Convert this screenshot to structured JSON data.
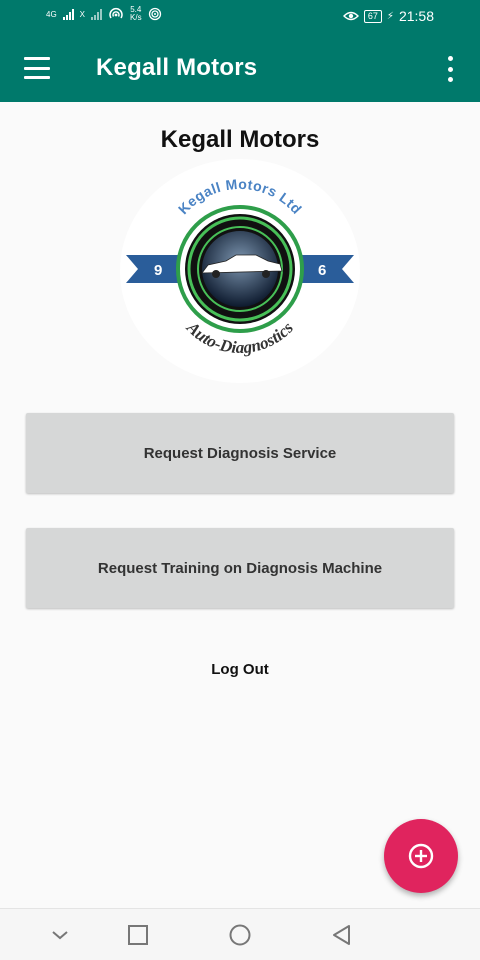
{
  "status_bar": {
    "network_left": "4G",
    "network_right": "X",
    "speed_value": "5.4",
    "speed_unit": "K/s",
    "battery": "67",
    "time": "21:58"
  },
  "app_bar": {
    "title": "Kegall Motors",
    "menu_icon": "hamburger-menu-icon",
    "overflow_icon": "more-vertical-icon"
  },
  "main": {
    "heading": "Kegall Motors",
    "logo": {
      "top_text": "Kegall Motors Ltd",
      "bottom_text": "Auto-Diagnostics",
      "left_number": "9",
      "right_number": "6"
    },
    "buttons": {
      "diagnosis": "Request Diagnosis Service",
      "training": "Request Training on Diagnosis Machine"
    },
    "logout": "Log Out"
  },
  "fab": {
    "icon": "add-circle-icon"
  },
  "nav_bar": {
    "icons": [
      "chevron-down-icon",
      "recents-square-icon",
      "home-circle-icon",
      "back-triangle-icon"
    ]
  },
  "colors": {
    "primary": "#00796b",
    "accent": "#e0245e",
    "button_bg": "#d6d7d7",
    "background": "#fafafa"
  }
}
